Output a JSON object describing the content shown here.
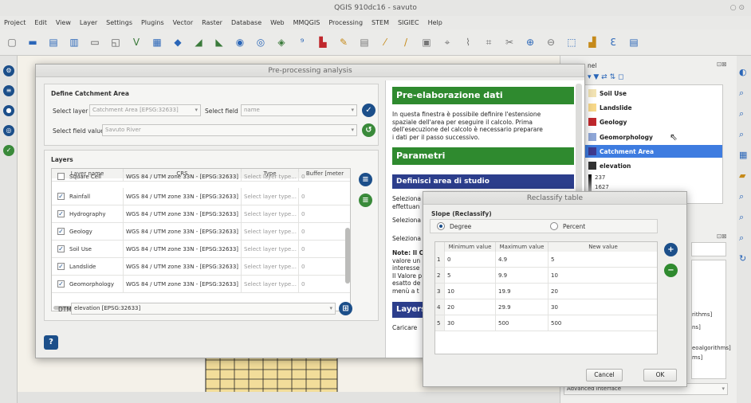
{
  "app": {
    "title": "QGIS 910dc16 - savuto"
  },
  "menu": [
    "Project",
    "Edit",
    "View",
    "Layer",
    "Settings",
    "Plugins",
    "Vector",
    "Raster",
    "Database",
    "Web",
    "MMQGIS",
    "Processing",
    "STEM",
    "SIGIEC",
    "Help"
  ],
  "pre": {
    "title": "Pre-processing analysis",
    "define_group": "Define Catchment Area",
    "select_layer_label": "Select layer",
    "select_layer_value": "Catchment Area [EPSG:32633]",
    "select_field_label": "Select field",
    "select_field_value": "name",
    "select_value_label": "Select field value",
    "select_value_value": "Savuto River",
    "layers_group": "Layers",
    "columns": [
      "Layer name",
      "CRS",
      "Type",
      "Buffer [meter"
    ],
    "rows": [
      {
        "name": "Square Cell",
        "crs": "WGS 84 / UTM zone 33N - [EPSG:32633]",
        "type": "Select layer type...",
        "buffer": "0",
        "checked": false
      },
      {
        "name": "Rainfall",
        "crs": "WGS 84 / UTM zone 33N - [EPSG:32633]",
        "type": "Select layer type...",
        "buffer": "0",
        "checked": true
      },
      {
        "name": "Hydrography",
        "crs": "WGS 84 / UTM zone 33N - [EPSG:32633]",
        "type": "Select layer type...",
        "buffer": "0",
        "checked": true
      },
      {
        "name": "Geology",
        "crs": "WGS 84 / UTM zone 33N - [EPSG:32633]",
        "type": "Select layer type...",
        "buffer": "0",
        "checked": true
      },
      {
        "name": "Soil Use",
        "crs": "WGS 84 / UTM zone 33N - [EPSG:32633]",
        "type": "Select layer type...",
        "buffer": "0",
        "checked": true
      },
      {
        "name": "Landslide",
        "crs": "WGS 84 / UTM zone 33N - [EPSG:32633]",
        "type": "Select layer type...",
        "buffer": "0",
        "checked": true
      },
      {
        "name": "Geomorphology",
        "crs": "WGS 84 / UTM zone 33N - [EPSG:32633]",
        "type": "Select layer type...",
        "buffer": "0",
        "checked": true
      }
    ],
    "dtm_label": "DTM",
    "dtm_value": "elevation [EPSG:32633]"
  },
  "help": {
    "h1": "Pre-elaborazione dati",
    "p1": [
      "In questa finestra è possibile definire l'estensione",
      "spaziale dell'area per eseguire il calcolo. Prima",
      "dell'esecuzione del calcolo è necessario preparare",
      "i dati per il passo successivo."
    ],
    "h2": "Parametri",
    "h3": "Definisci area di studio",
    "p2": [
      "Seleziona",
      "effettuan"
    ],
    "p3": "Seleziona",
    "p4": "Seleziona",
    "note": [
      "Note: Il C",
      "valore un",
      "interesse",
      "Il Valore p",
      "esatto de",
      "menù a t"
    ],
    "h4": "Layers",
    "p5": "Caricare"
  },
  "reclass": {
    "title": "Reclassify table",
    "group": "Slope (Reclassify)",
    "opt_degree": "Degree",
    "opt_percent": "Percent",
    "columns": [
      "Minimum value",
      "Maximum value",
      "New value"
    ],
    "rows": [
      {
        "idx": "1",
        "min": "0",
        "max": "4.9",
        "new": "5"
      },
      {
        "idx": "2",
        "min": "5",
        "max": "9.9",
        "new": "10"
      },
      {
        "idx": "3",
        "min": "10",
        "max": "19.9",
        "new": "20"
      },
      {
        "idx": "4",
        "min": "20",
        "max": "29.9",
        "new": "30"
      },
      {
        "idx": "5",
        "min": "30",
        "max": "500",
        "new": "500"
      }
    ],
    "cancel": "Cancel",
    "ok": "OK"
  },
  "layers_panel": {
    "title": "nel",
    "items": [
      {
        "name": "Soil Use",
        "color": "#f2e3b3"
      },
      {
        "name": "Landslide",
        "color": "#f7d88a"
      },
      {
        "name": "Geology",
        "color": "#c0282d"
      },
      {
        "name": "Geomorphology",
        "color": "#8fa7d8"
      },
      {
        "name": "Catchment Area",
        "color": "#3f3a8f"
      },
      {
        "name": "elevation",
        "color": "#333333"
      }
    ],
    "legend_values": [
      "237",
      "1627"
    ],
    "frag1": "rithms]",
    "frag2": "ns]",
    "frag3": "eoalgorithms]",
    "frag4": "ms]",
    "advanced": "Advanced interface"
  }
}
